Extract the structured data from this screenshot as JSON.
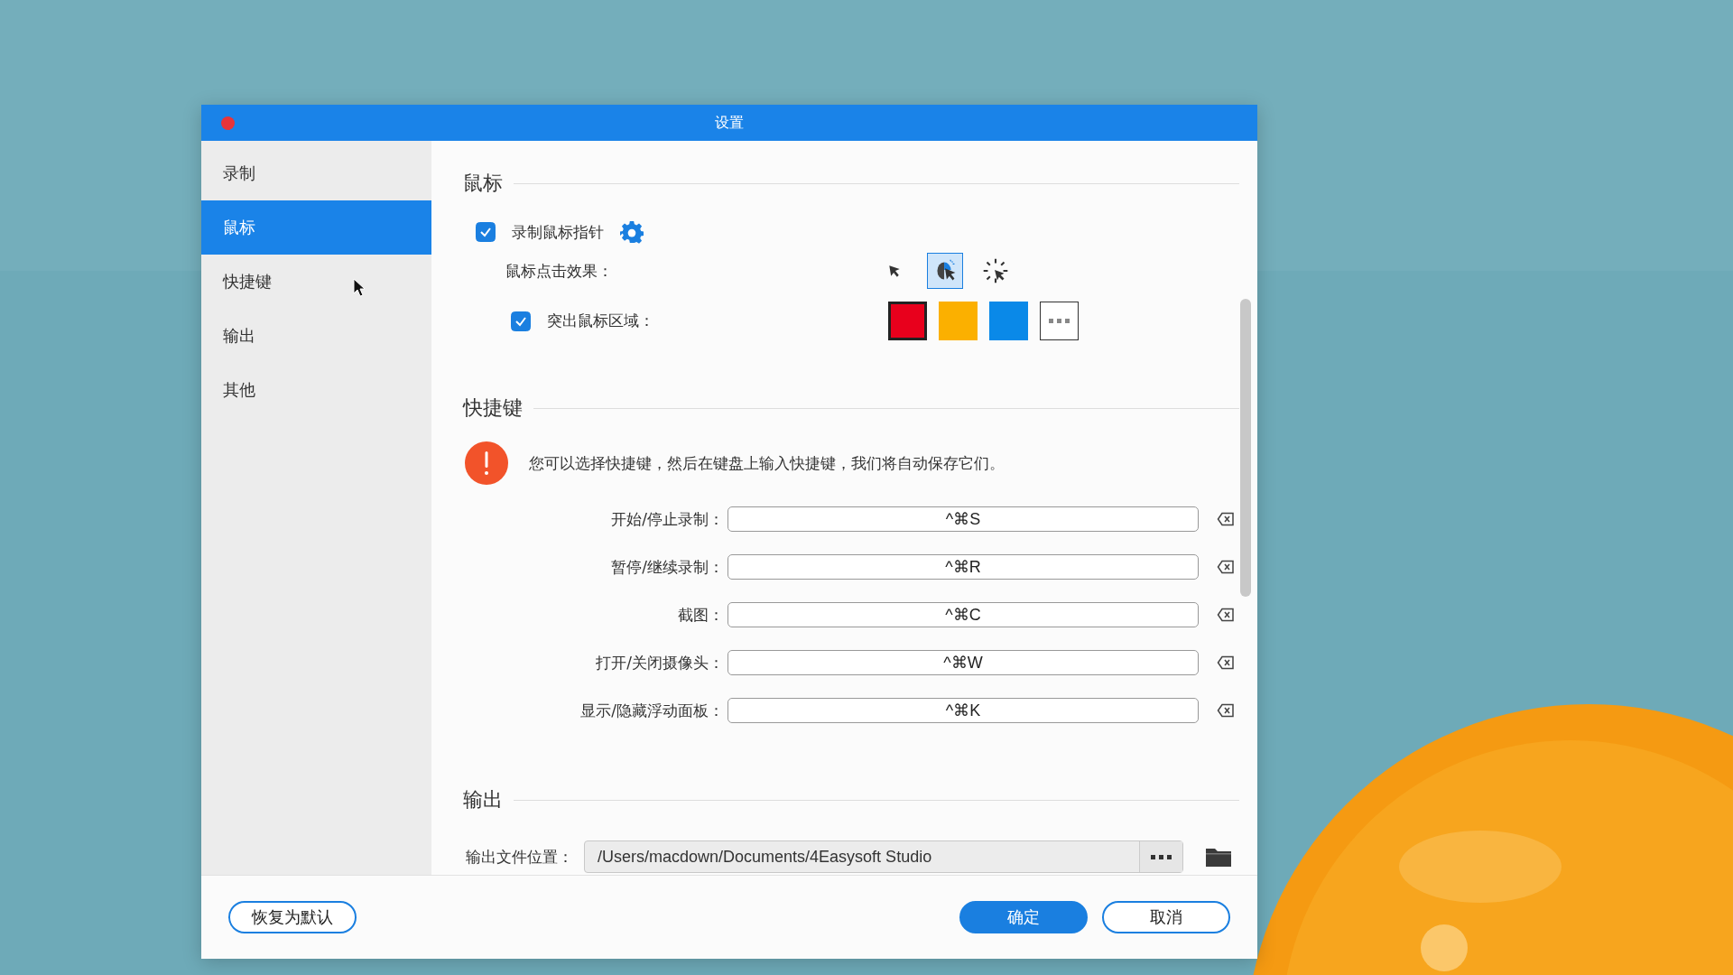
{
  "window": {
    "title": "设置",
    "close_button": true
  },
  "sidebar": {
    "items": [
      {
        "label": "录制",
        "selected": false
      },
      {
        "label": "鼠标",
        "selected": true
      },
      {
        "label": "快捷键",
        "selected": false
      },
      {
        "label": "输出",
        "selected": false
      },
      {
        "label": "其他",
        "selected": false
      }
    ]
  },
  "mouse": {
    "heading": "鼠标",
    "record_pointer": {
      "label": "录制鼠标指针",
      "checked": true
    },
    "click_effect": {
      "label": "鼠标点击效果：",
      "options": [
        {
          "kind": "arrow",
          "selected": false
        },
        {
          "kind": "ripple",
          "selected": true
        },
        {
          "kind": "burst",
          "selected": false
        }
      ]
    },
    "highlight": {
      "label": "突出鼠标区域：",
      "checked": true,
      "colors": [
        {
          "color": "#e8001c",
          "selected": true
        },
        {
          "color": "#fbb000",
          "selected": false
        },
        {
          "color": "#0a89e8",
          "selected": false
        }
      ]
    }
  },
  "shortcuts": {
    "heading": "快捷键",
    "info": "您可以选择快捷键，然后在键盘上输入快捷键，我们将自动保存它们。",
    "items": [
      {
        "label": "开始/停止录制：",
        "value": "^⌘S"
      },
      {
        "label": "暂停/继续录制：",
        "value": "^⌘R"
      },
      {
        "label": "截图：",
        "value": "^⌘C"
      },
      {
        "label": "打开/关闭摄像头：",
        "value": "^⌘W"
      },
      {
        "label": "显示/隐藏浮动面板：",
        "value": "^⌘K"
      }
    ]
  },
  "output": {
    "heading": "输出",
    "location_label": "输出文件位置：",
    "location_value": "/Users/macdown/Documents/4Easysoft Studio"
  },
  "footer": {
    "reset_button": "恢复为默认",
    "ok_button": "确定",
    "cancel_button": "取消"
  }
}
